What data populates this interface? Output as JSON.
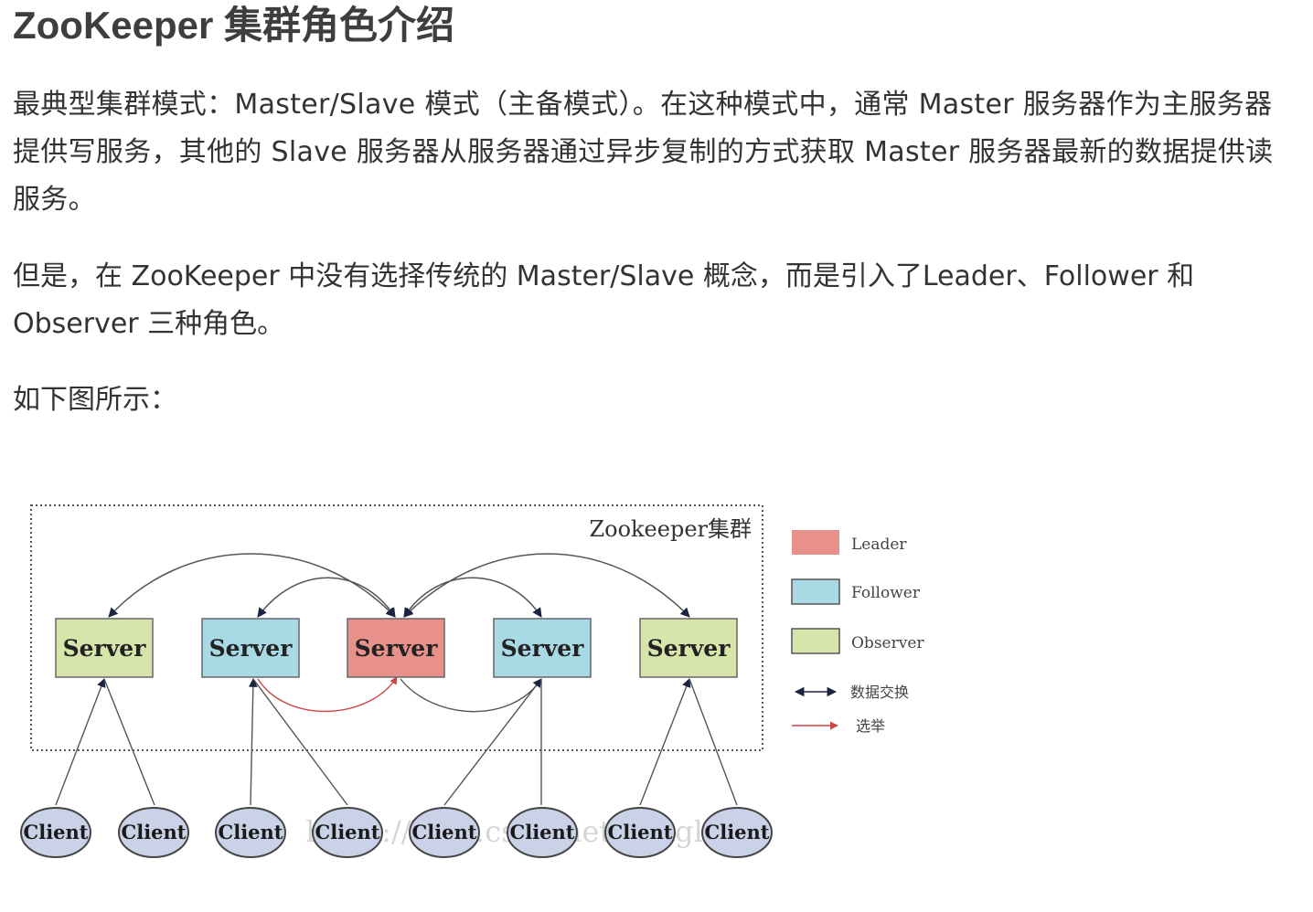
{
  "article": {
    "title": "ZooKeeper 集群角色介绍",
    "paragraphs": [
      "最典型集群模式：Master/Slave 模式（主备模式）。在这种模式中，通常 Master 服务器作为主服务器提供写服务，其他的 Slave 服务器从服务器通过异步复制的方式获取 Master 服务器最新的数据提供读服务。",
      "但是，在 ZooKeeper 中没有选择传统的 Master/Slave 概念，而是引入了Leader、Follower 和 Observer 三种角色。",
      "如下图所示："
    ]
  },
  "diagram": {
    "cluster_label": "Zookeeper集群",
    "servers": [
      {
        "label": "Server",
        "role": "observer"
      },
      {
        "label": "Server",
        "role": "follower"
      },
      {
        "label": "Server",
        "role": "leader"
      },
      {
        "label": "Server",
        "role": "follower"
      },
      {
        "label": "Server",
        "role": "observer"
      }
    ],
    "clients": [
      "Client",
      "Client",
      "Client",
      "Client",
      "Client",
      "Client",
      "Client",
      "Client"
    ],
    "legend": [
      {
        "label": "Leader",
        "color": "#e8918a"
      },
      {
        "label": "Follower",
        "color": "#a9d9e4"
      },
      {
        "label": "Observer",
        "color": "#d7e4aa"
      },
      {
        "label": "数据交换",
        "symbol": "double-arrow"
      },
      {
        "label": "选举",
        "symbol": "red-arrow"
      }
    ],
    "watermark": "https://blog.csdn.net/kanglou",
    "colors": {
      "leader": "#e8918a",
      "follower": "#a9d9e4",
      "observer": "#d7e4aa",
      "client": "#c9d2e6",
      "election_arrow": "#cc4444"
    }
  }
}
